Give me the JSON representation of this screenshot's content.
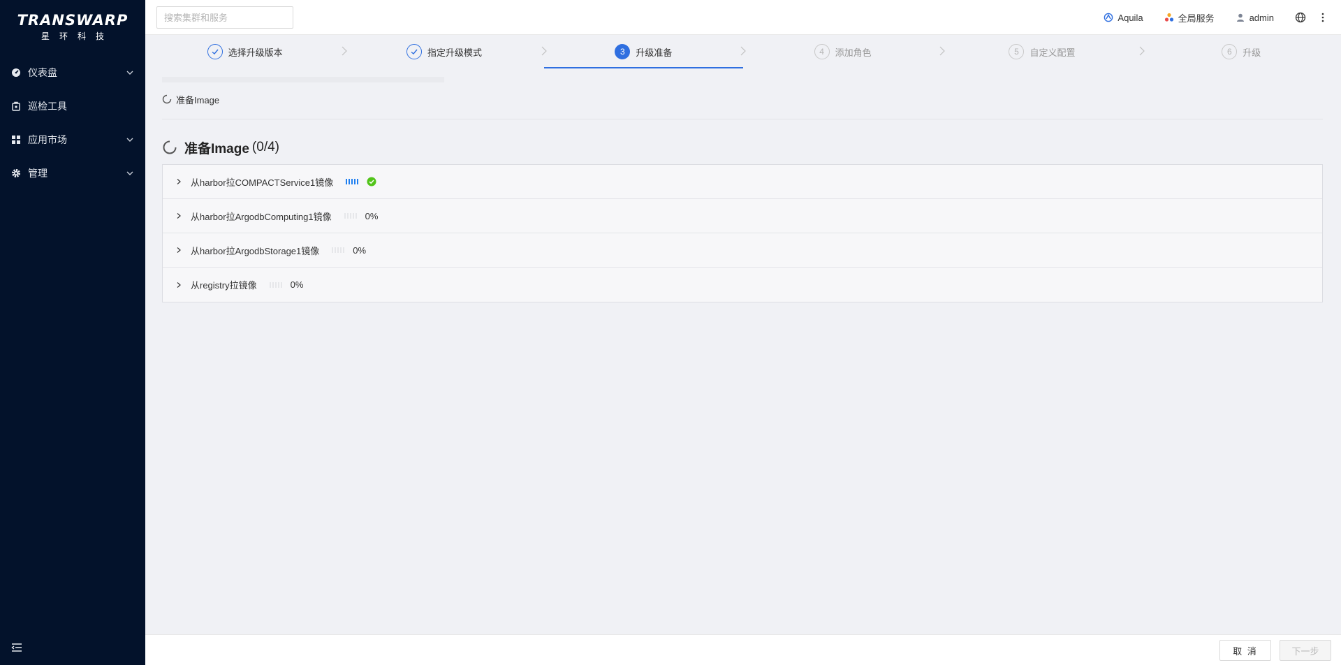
{
  "brand": {
    "name": "TRANSWARP",
    "sub": "星环科技"
  },
  "sidebar": {
    "items": [
      {
        "label": "仪表盘",
        "icon": "dashboard-icon",
        "has_children": true
      },
      {
        "label": "巡检工具",
        "icon": "inspection-icon",
        "has_children": false
      },
      {
        "label": "应用市场",
        "icon": "app-market-icon",
        "has_children": true
      },
      {
        "label": "管理",
        "icon": "gear-icon",
        "has_children": true
      }
    ]
  },
  "header": {
    "search_placeholder": "搜索集群和服务",
    "aquila_label": "Aquila",
    "global_service_label": "全局服务",
    "user_label": "admin"
  },
  "steps": [
    {
      "label": "选择升级版本",
      "state": "done",
      "num": "1"
    },
    {
      "label": "指定升级模式",
      "state": "done",
      "num": "2"
    },
    {
      "label": "升级准备",
      "state": "active",
      "num": "3"
    },
    {
      "label": "添加角色",
      "state": "todo",
      "num": "4"
    },
    {
      "label": "自定义配置",
      "state": "todo",
      "num": "5"
    },
    {
      "label": "升级",
      "state": "todo",
      "num": "6"
    }
  ],
  "main": {
    "status_text": "准备Image",
    "section_title": "准备Image",
    "section_count": "(0/4)",
    "tasks": [
      {
        "label": "从harbor拉COMPACTService1镜像",
        "status": "done",
        "percent": "",
        "progress": 1.0
      },
      {
        "label": "从harbor拉ArgodbComputing1镜像",
        "status": "running",
        "percent": "0%",
        "progress": 0.0
      },
      {
        "label": "从harbor拉ArgodbStorage1镜像",
        "status": "running",
        "percent": "0%",
        "progress": 0.0
      },
      {
        "label": "从registry拉镜像",
        "status": "running",
        "percent": "0%",
        "progress": 0.0
      }
    ]
  },
  "footer": {
    "cancel_label": "取 消",
    "next_label": "下一步"
  },
  "colors": {
    "primary": "#2f6fe0",
    "sidebar_bg": "#03122b",
    "success": "#52c41a"
  }
}
